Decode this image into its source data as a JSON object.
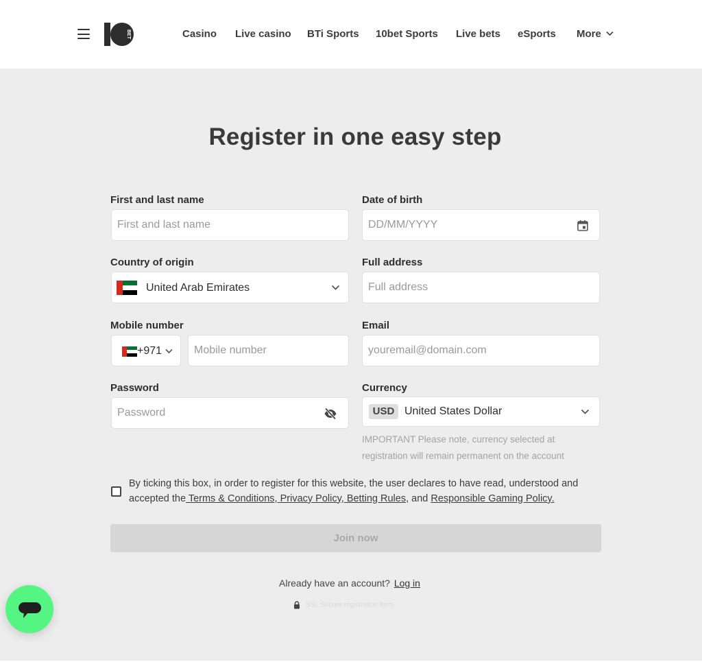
{
  "header": {
    "menu_icon": "hamburger-icon",
    "logo_icon": "10bet-logo",
    "nav": [
      {
        "label": "Casino"
      },
      {
        "label": "Live casino"
      },
      {
        "label": "BTi Sports"
      },
      {
        "label": "10bet Sports"
      },
      {
        "label": "Live bets"
      },
      {
        "label": "eSports"
      },
      {
        "label": "More"
      }
    ]
  },
  "form": {
    "title": "Register in one easy step",
    "name": {
      "label": "First and last name",
      "placeholder": "First and last name"
    },
    "dob": {
      "label": "Date of birth",
      "placeholder": "DD/MM/YYYY",
      "icon": "calendar-icon"
    },
    "country": {
      "label": "Country of origin",
      "value": "United Arab Emirates",
      "flag": "uae-flag"
    },
    "address": {
      "label": "Full address",
      "placeholder": "Full address"
    },
    "mobile": {
      "label": "Mobile number",
      "code": "+971",
      "placeholder": "Mobile number"
    },
    "email": {
      "label": "Email",
      "placeholder": "youremail@domain.com"
    },
    "password": {
      "label": "Password",
      "placeholder": "Password",
      "icon": "eye-off-icon"
    },
    "currency": {
      "label": "Currency",
      "code": "USD",
      "value": "United States Dollar",
      "note": "IMPORTANT Please note, currency selected at registration will remain permanent on the account"
    },
    "terms": {
      "prefix": "By ticking this box, in order to register for this website, the user declares to have read, understood and accepted the",
      "terms_link": " Terms & Conditions,",
      "privacy_link": " Privacy Policy,",
      "betting_link": " Betting Rules",
      "and_text": ", and ",
      "rg_link": "Responsible Gaming Policy."
    },
    "join_label": "Join now",
    "already_text": "Already have an account?",
    "login_link": "Log in",
    "ssl_text": "SSL Secure registration form"
  },
  "colors": {
    "page_bg": "#ededed",
    "header_bg": "#ffffff",
    "chat_button": "#54f583",
    "flag_red": "#d52b1e",
    "flag_green": "#00732f",
    "flag_black": "#000000"
  },
  "chat": {
    "icon": "chat-bubble-icon"
  }
}
